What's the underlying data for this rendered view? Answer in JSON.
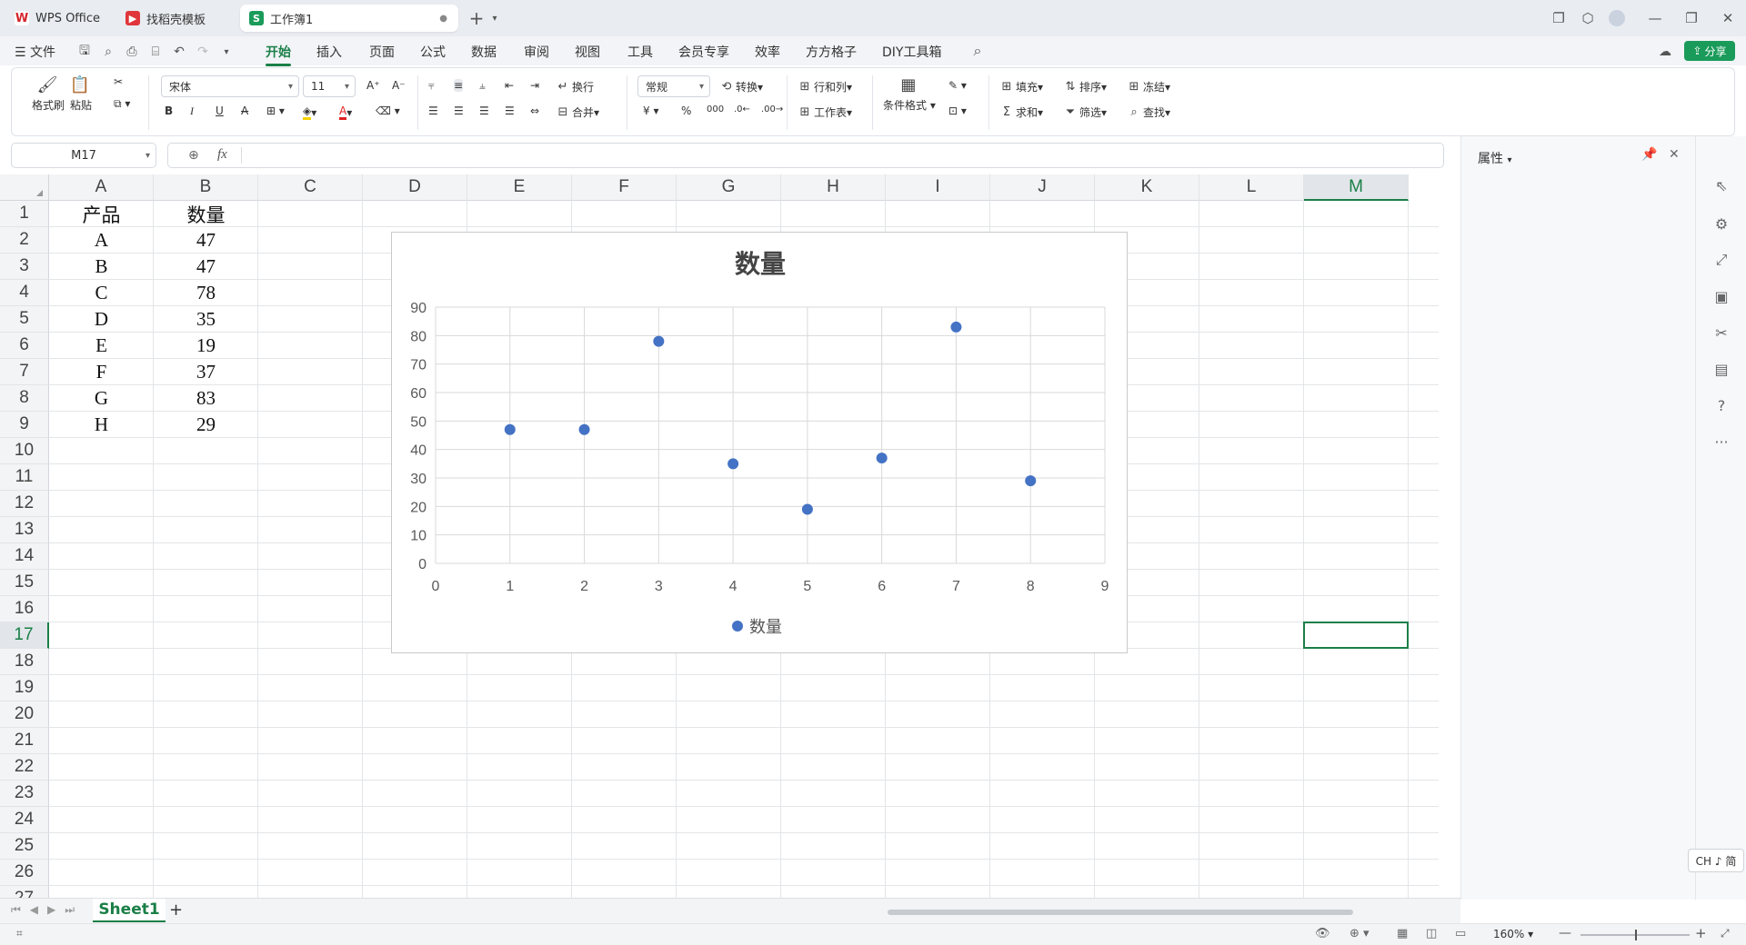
{
  "tabs": [
    {
      "label": "WPS Office",
      "icon": "wps-logo-icon"
    },
    {
      "label": "找稻壳模板",
      "icon": "docer-icon"
    },
    {
      "label": "工作簿1",
      "icon": "sheet-icon"
    }
  ],
  "menu": [
    "文件",
    "开始",
    "插入",
    "页面",
    "公式",
    "数据",
    "审阅",
    "视图",
    "工具",
    "会员专享",
    "效率",
    "方方格子",
    "DIY工具箱"
  ],
  "share_label": "分享",
  "ribbon": {
    "format_painter": "格式刷",
    "paste": "粘贴",
    "font_name": "宋体",
    "font_size": "11",
    "wrap": "换行",
    "merge": "合并",
    "number_format": "常规",
    "convert": "转换",
    "row_col": "行和列",
    "worksheet": "工作表",
    "cond_format": "条件格式",
    "fill": "填充",
    "sort": "排序",
    "freeze": "冻结",
    "sum": "求和",
    "filter": "筛选",
    "find": "查找"
  },
  "formula_bar": {
    "name_box": "M17",
    "fx": "fx",
    "value": ""
  },
  "columns": [
    "A",
    "B",
    "C",
    "D",
    "E",
    "F",
    "G",
    "H",
    "I",
    "J",
    "K",
    "L",
    "M"
  ],
  "rows": [
    "1",
    "2",
    "3",
    "4",
    "5",
    "6",
    "7",
    "8",
    "9",
    "10",
    "11",
    "12",
    "13",
    "14",
    "15",
    "16",
    "17",
    "18",
    "19",
    "20",
    "21",
    "22",
    "23",
    "24",
    "25",
    "26",
    "27"
  ],
  "selected_cell": "M17",
  "sheet_cells": {
    "A1": "产品",
    "B1": "数量",
    "A2": "A",
    "B2": "47",
    "A3": "B",
    "B3": "47",
    "A4": "C",
    "B4": "78",
    "A5": "D",
    "B5": "35",
    "A6": "E",
    "B6": "19",
    "A7": "F",
    "B7": "37",
    "A8": "G",
    "B8": "83",
    "A9": "H",
    "B9": "29"
  },
  "chart_data": {
    "type": "scatter",
    "title": "数量",
    "x": [
      1,
      2,
      3,
      4,
      5,
      6,
      7,
      8
    ],
    "series": [
      {
        "name": "数量",
        "values": [
          47,
          47,
          78,
          35,
          19,
          37,
          83,
          29
        ],
        "color": "#4472c4"
      }
    ],
    "xlim": [
      0,
      9
    ],
    "ylim": [
      0,
      90
    ],
    "x_ticks": [
      0,
      1,
      2,
      3,
      4,
      5,
      6,
      7,
      8,
      9
    ],
    "y_ticks": [
      0,
      10,
      20,
      30,
      40,
      50,
      60,
      70,
      80,
      90
    ],
    "grid": true,
    "legend": "bottom"
  },
  "side_panel": {
    "title": "属性"
  },
  "sheet_tabs": [
    {
      "label": "Sheet1",
      "active": true
    }
  ],
  "status": {
    "zoom": "160%",
    "ime": "CH ♪ 简"
  },
  "accent_color": "#1a7f47"
}
